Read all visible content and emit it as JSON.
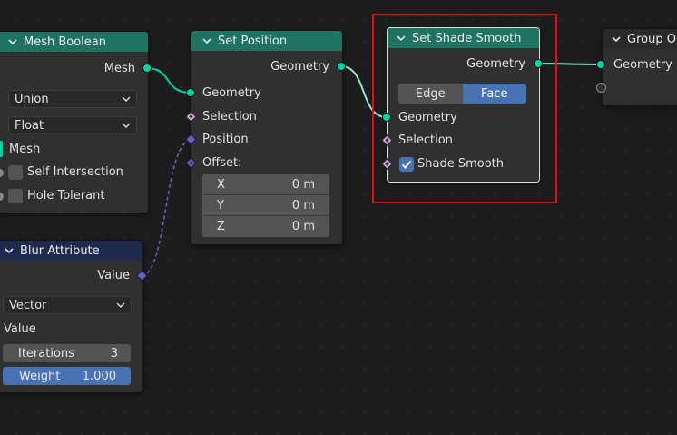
{
  "nodes": {
    "mesh_boolean": {
      "title": "Mesh Boolean",
      "output_mesh": "Mesh",
      "operation": "Union",
      "solver": "Float",
      "input_mesh": "Mesh",
      "self_intersection": "Self Intersection",
      "hole_tolerant": "Hole Tolerant"
    },
    "set_position": {
      "title": "Set Position",
      "output_geometry": "Geometry",
      "input_geometry": "Geometry",
      "selection": "Selection",
      "position": "Position",
      "offset": "Offset:",
      "offset_x_label": "X",
      "offset_x_value": "0 m",
      "offset_y_label": "Y",
      "offset_y_value": "0 m",
      "offset_z_label": "Z",
      "offset_z_value": "0 m"
    },
    "set_shade_smooth": {
      "title": "Set Shade Smooth",
      "output_geometry": "Geometry",
      "domain_edge": "Edge",
      "domain_face": "Face",
      "input_geometry": "Geometry",
      "selection": "Selection",
      "shade_smooth": "Shade Smooth",
      "shade_smooth_checked": true
    },
    "group_output": {
      "title": "Group Ou",
      "input_geometry": "Geometry"
    },
    "blur_attribute": {
      "title": "Blur Attribute",
      "output_value": "Value",
      "data_type": "Vector",
      "value_label": "Value",
      "iterations_label": "Iterations",
      "iterations_value": "3",
      "weight_label": "Weight",
      "weight_value": "1.000"
    }
  },
  "colors": {
    "geometry_socket": "#00d6a3",
    "vector_socket": "#6363c7",
    "field_socket": "#cca6d6",
    "geometry_header": "#1e7461",
    "attribute_header": "#1e2b4c",
    "highlight": "#e01010",
    "active_blue": "#4772b3"
  }
}
